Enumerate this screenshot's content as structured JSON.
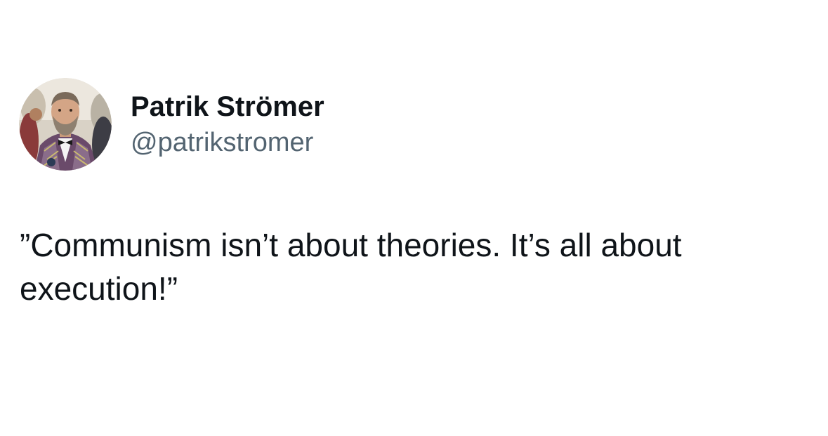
{
  "author": {
    "display_name": "Patrik Strömer",
    "handle": "@patrikstromer",
    "avatar_icon": "profile-photo"
  },
  "tweet": {
    "text": "”Communism isn’t about theories. It’s all about execution!”"
  },
  "colors": {
    "background": "#ffffff",
    "name_text": "#0f1419",
    "handle_text": "#536471",
    "body_text": "#0f1419"
  }
}
